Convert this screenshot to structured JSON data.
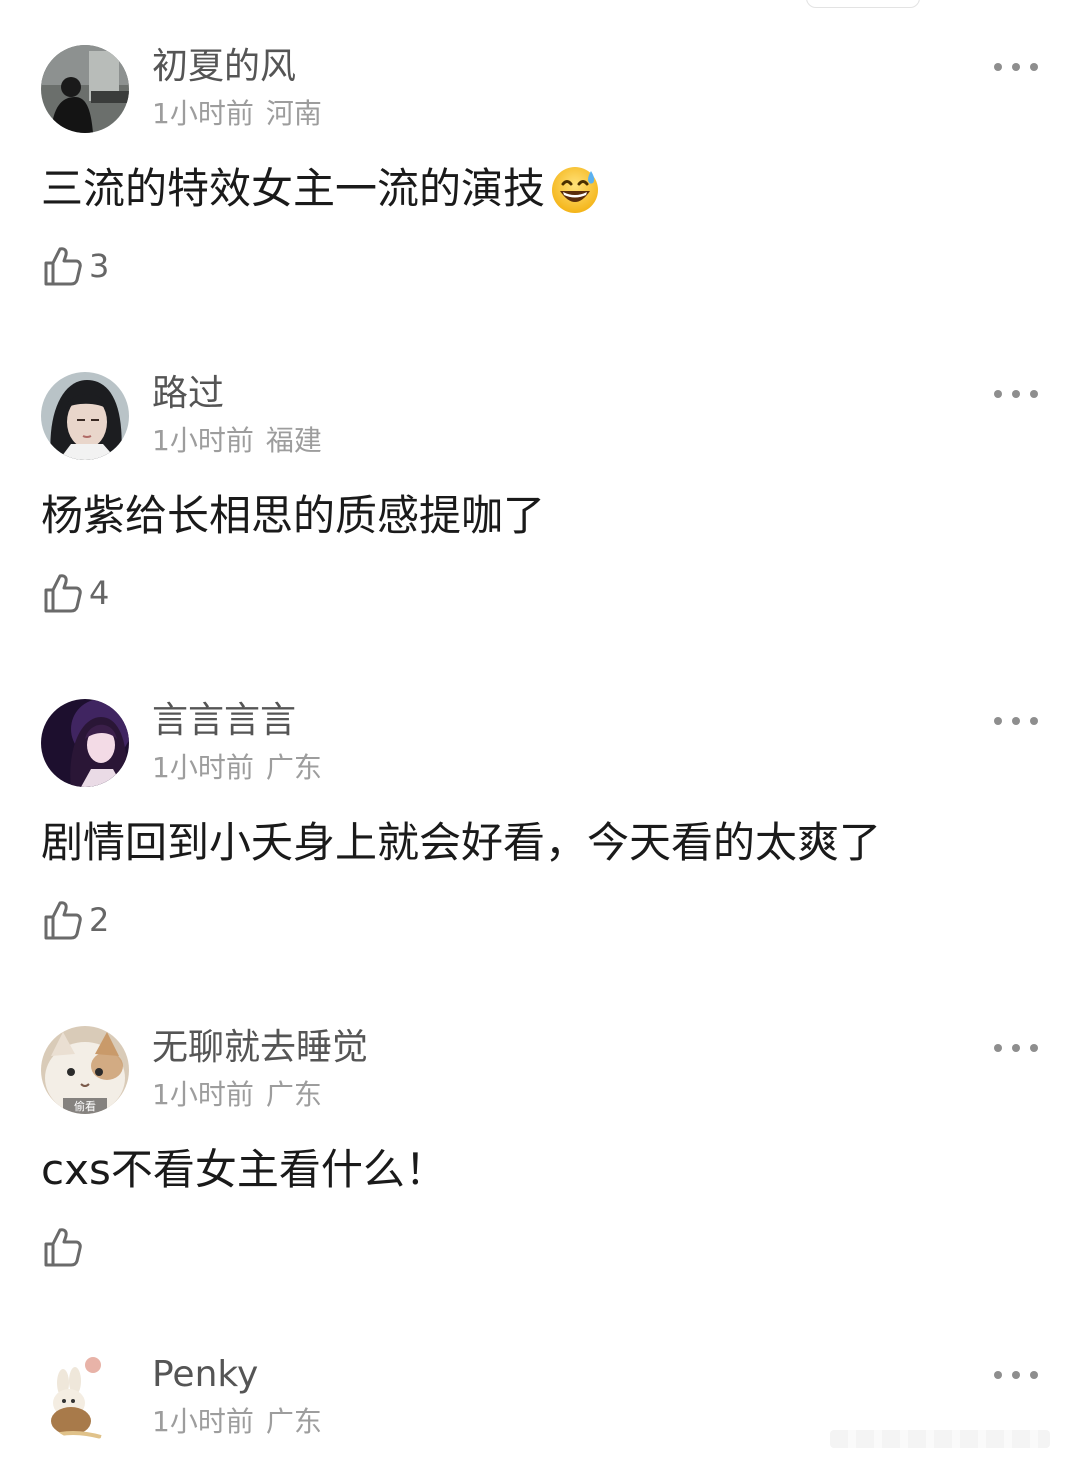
{
  "comments": [
    {
      "username": "初夏的风",
      "time": "1小时前",
      "location": "河南",
      "text": "三流的特效女主一流的演技",
      "emoji": "😅",
      "likes": "3"
    },
    {
      "username": "路过",
      "time": "1小时前",
      "location": "福建",
      "text": "杨紫给长相思的质感提咖了",
      "likes": "4"
    },
    {
      "username": "言言言言",
      "time": "1小时前",
      "location": "广东",
      "text": "剧情回到小夭身上就会好看，今天看的太爽了",
      "likes": "2"
    },
    {
      "username": "无聊就去睡觉",
      "time": "1小时前",
      "location": "广东",
      "text": "cxs不看女主看什么！",
      "likes": "",
      "avatar_caption": "偷看"
    },
    {
      "username": "Penky",
      "time": "1小时前",
      "location": "广东"
    }
  ],
  "icons": {
    "like": "thumbs-up-outline-icon",
    "more": "ellipsis-horizontal-icon",
    "emoji": "grinning-face-with-sweat-emoji"
  },
  "colors": {
    "username": "#555555",
    "meta": "#9d9d9d",
    "text": "#1a1a1a",
    "icon": "#6a6a6a"
  }
}
